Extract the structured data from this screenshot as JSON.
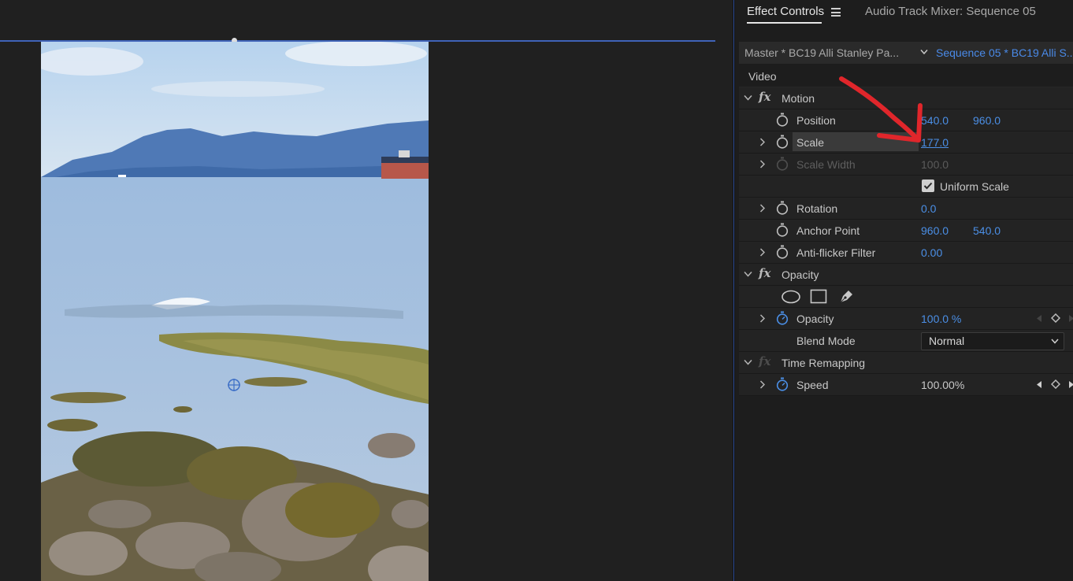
{
  "tabs": {
    "effect_controls": "Effect Controls",
    "audio_mixer": "Audio Track Mixer: Sequence 05"
  },
  "source": {
    "master": "Master * BC19 Alli Stanley Pa...",
    "sequence": "Sequence 05 * BC19 Alli S..."
  },
  "section_video": "Video",
  "motion": {
    "title": "Motion",
    "position": {
      "label": "Position",
      "x": "540.0",
      "y": "960.0"
    },
    "scale": {
      "label": "Scale",
      "value": "177.0"
    },
    "scale_width": {
      "label": "Scale Width",
      "value": "100.0"
    },
    "uniform_scale": {
      "label": "Uniform Scale",
      "checked": true
    },
    "rotation": {
      "label": "Rotation",
      "value": "0.0"
    },
    "anchor_point": {
      "label": "Anchor Point",
      "x": "960.0",
      "y": "540.0"
    },
    "anti_flicker": {
      "label": "Anti-flicker Filter",
      "value": "0.00"
    }
  },
  "opacity": {
    "title": "Opacity",
    "opacity": {
      "label": "Opacity",
      "value": "100.0 %"
    },
    "blend_mode": {
      "label": "Blend Mode",
      "value": "Normal"
    }
  },
  "time_remapping": {
    "title": "Time Remapping",
    "speed": {
      "label": "Speed",
      "value": "100.00%"
    }
  },
  "colors": {
    "accent_blue": "#4b8fe6",
    "annotation_red": "#e0262b",
    "panel_bg": "#1d1d1d",
    "row_bg": "#232323"
  },
  "icons": [
    "menu-icon",
    "chevron-down-icon",
    "fx-icon",
    "stopwatch-icon",
    "ellipse-mask-icon",
    "rectangle-mask-icon",
    "pen-mask-icon",
    "keyframe-icon",
    "arrow-annotation"
  ]
}
